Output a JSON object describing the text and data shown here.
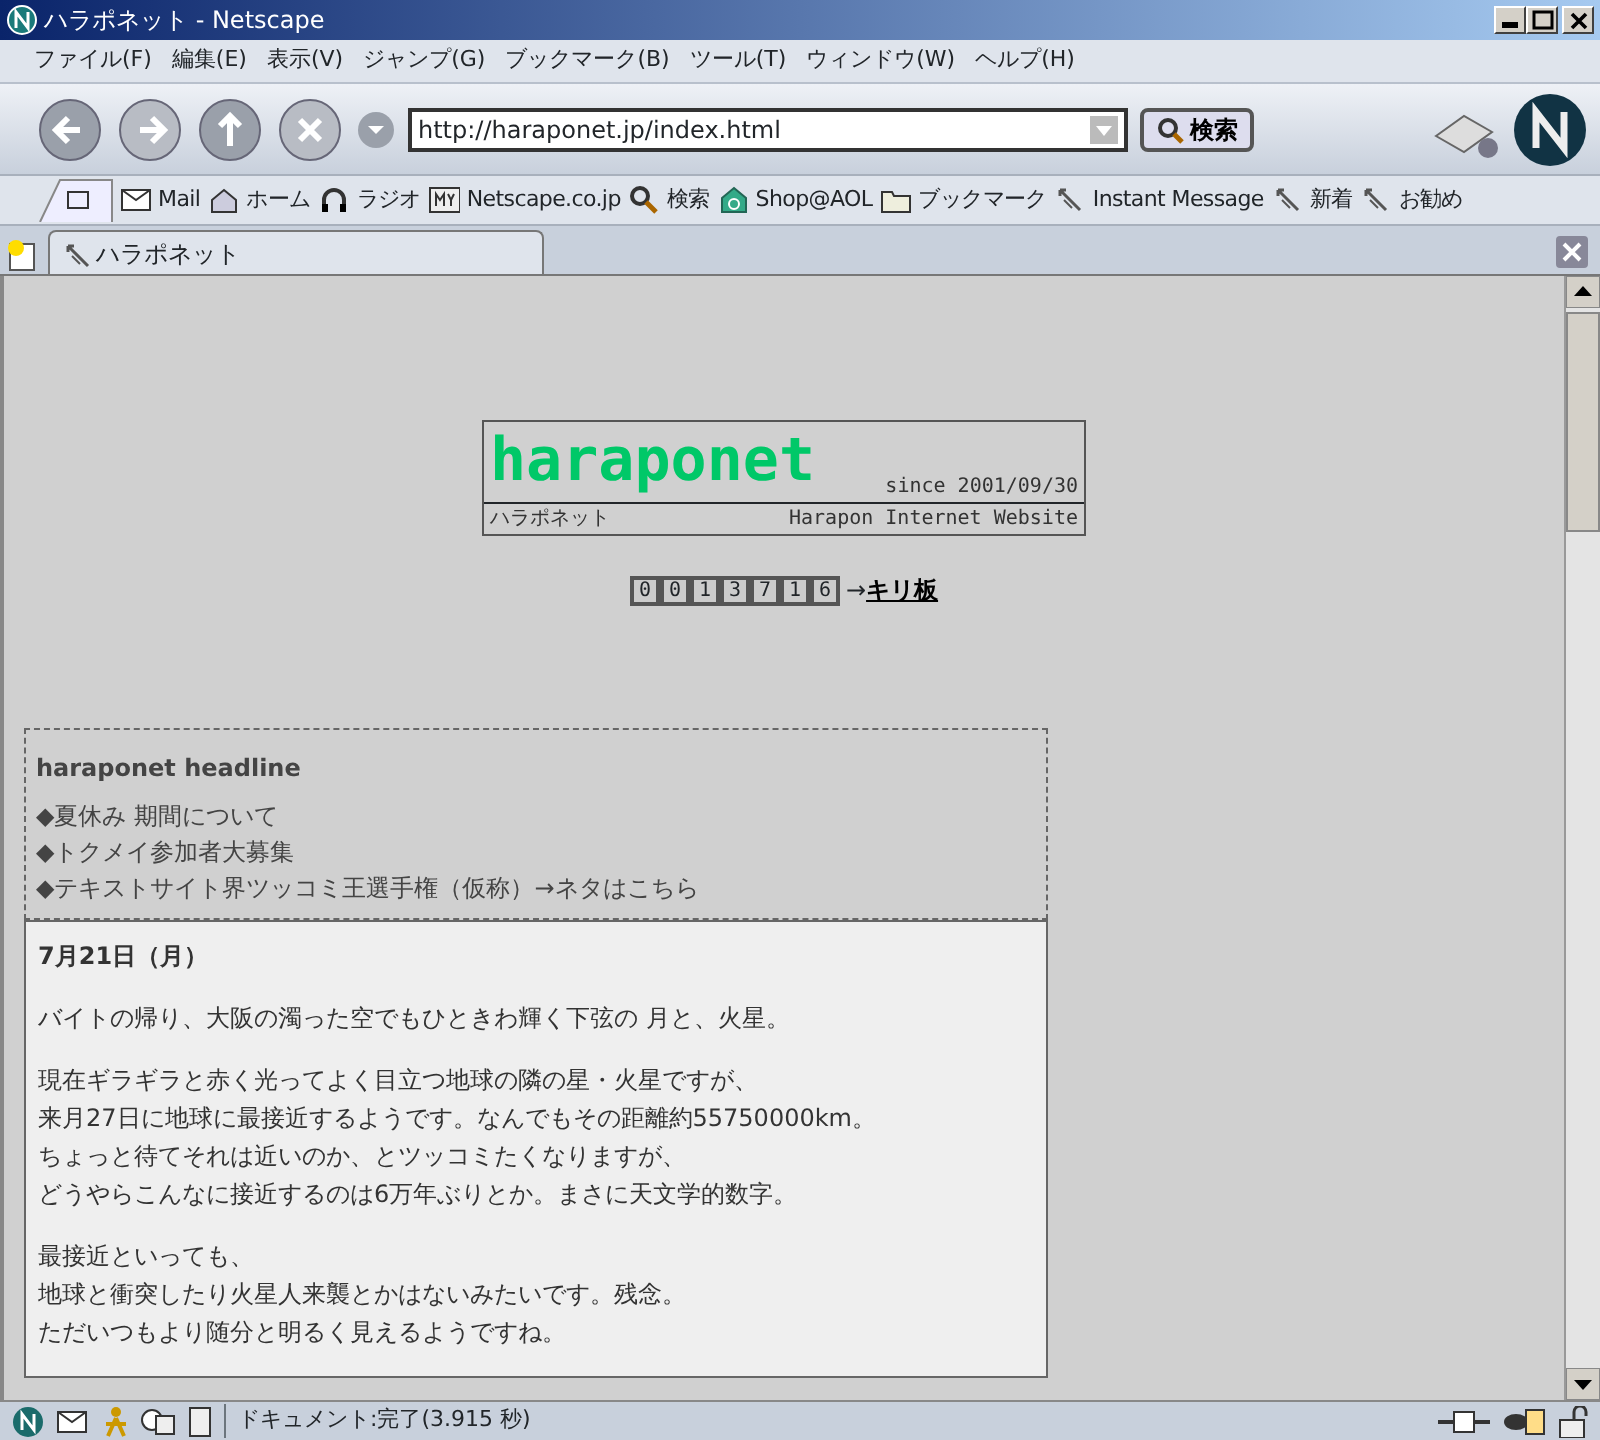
{
  "window": {
    "title": "ハラポネット - Netscape"
  },
  "menu": [
    "ファイル(F)",
    "編集(E)",
    "表示(V)",
    "ジャンプ(G)",
    "ブックマーク(B)",
    "ツール(T)",
    "ウィンドウ(W)",
    "ヘルプ(H)"
  ],
  "navigation": {
    "url": "http://haraponet.jp/index.html",
    "search_button": "検索"
  },
  "personal_toolbar": [
    {
      "kind": "mail",
      "label": "Mail"
    },
    {
      "kind": "home",
      "label": "ホーム"
    },
    {
      "kind": "radio",
      "label": "ラジオ"
    },
    {
      "kind": "my",
      "label": "Netscape.co.jp"
    },
    {
      "kind": "search",
      "label": "検索"
    },
    {
      "kind": "shop",
      "label": "Shop@AOL"
    },
    {
      "kind": "folder",
      "label": "ブックマーク"
    },
    {
      "kind": "link",
      "label": "Instant Message"
    },
    {
      "kind": "link",
      "label": "新着"
    },
    {
      "kind": "link",
      "label": "お勧め"
    }
  ],
  "tabs": [
    {
      "label": "ハラポネット",
      "selected": true
    }
  ],
  "page": {
    "logo": {
      "title": "haraponet",
      "kana": "ハラポネット",
      "since": "since 2001/09/30",
      "subtitle": "Harapon Internet Website"
    },
    "counter": {
      "digits": [
        "0",
        "0",
        "1",
        "3",
        "7",
        "1",
        "6"
      ],
      "arrow": "→",
      "link": "キリ板"
    },
    "headline": {
      "title": "haraponet headline",
      "items": [
        {
          "bullet": "◆",
          "text": "夏休み 期間について"
        },
        {
          "bullet": "◆",
          "text": "トクメイ参加者大募集"
        },
        {
          "bullet": "◆",
          "text": "テキストサイト界ツッコミ王選手権（仮称）→ネタは",
          "link": "こちら"
        }
      ]
    },
    "diary": {
      "date": "7月21日（月）",
      "paragraphs": [
        [
          "バイトの帰り、大阪の濁った空でもひときわ輝く下弦の 月と、火星。"
        ],
        [
          "現在ギラギラと赤く光ってよく目立つ地球の隣の星・火星ですが、",
          "来月27日に地球に最接近するようです。なんでもその距離約55750000km。",
          "ちょっと待てそれは近いのか、とツッコミたくなりますが、",
          "どうやらこんなに接近するのは6万年ぶりとか。まさに天文学的数字。"
        ],
        [
          "最接近といっても、",
          "地球と衝突したり火星人来襲とかはないみたいです。残念。",
          "ただいつもより随分と明るく見えるようですね。"
        ]
      ]
    }
  },
  "status_bar": {
    "text": "ドキュメント:完了(3.915 秒)"
  }
}
